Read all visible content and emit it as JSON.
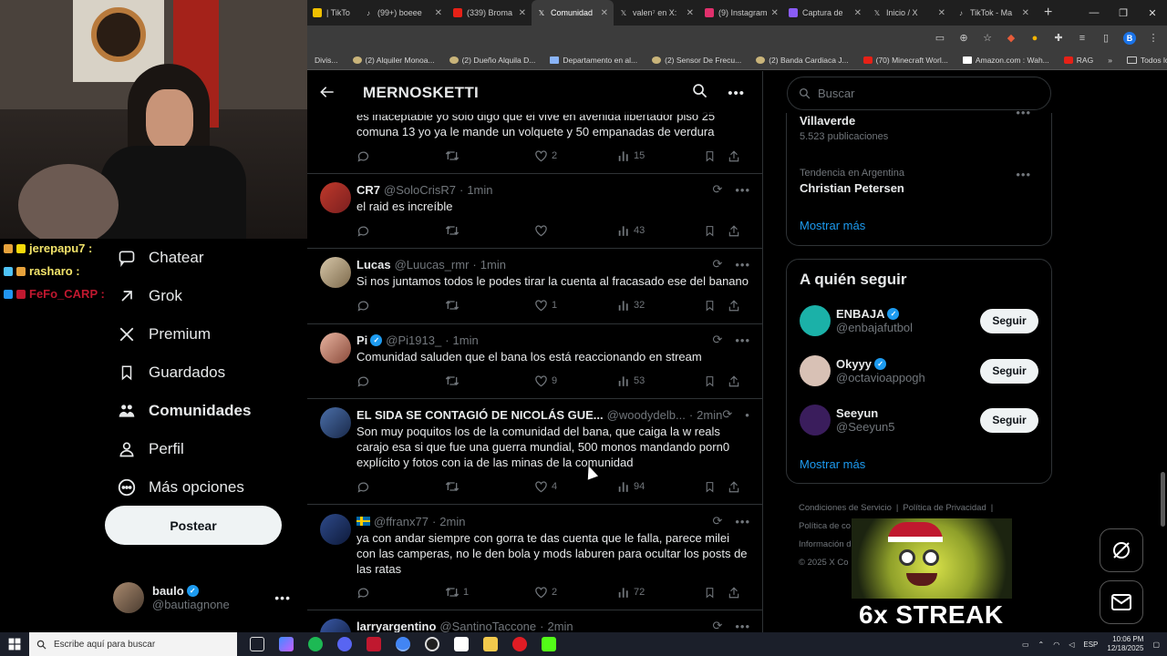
{
  "browser": {
    "tabs": [
      {
        "label": "| TikTo",
        "color": "#f0c000"
      },
      {
        "label": "(99+) boeee",
        "color": "#ffffff"
      },
      {
        "label": "(339) Broma",
        "color": "#e62117"
      },
      {
        "label": "Comunidad",
        "color": "#ffffff",
        "active": true
      },
      {
        "label": "valen⁷ en X:",
        "color": "#ffffff"
      },
      {
        "label": "(9) Instagram",
        "color": "#e1306c"
      },
      {
        "label": "Captura de",
        "color": "#8a5cf6"
      },
      {
        "label": "Inicio / X",
        "color": "#ffffff"
      },
      {
        "label": "TikTok - Ma",
        "color": "#ffffff"
      }
    ],
    "profile_initial": "B",
    "bookmarks": [
      {
        "label": "Divis...",
        "kind": "gen"
      },
      {
        "label": "(2) Alquiler Monoa...",
        "kind": "gen"
      },
      {
        "label": "(2) Dueño Alquila D...",
        "kind": "gen"
      },
      {
        "label": "Departamento en al...",
        "kind": "img"
      },
      {
        "label": "(2) Sensor De Frecu...",
        "kind": "gen"
      },
      {
        "label": "(2) Banda Cardiaca J...",
        "kind": "gen"
      },
      {
        "label": "(70) Minecraft Worl...",
        "kind": "yt"
      },
      {
        "label": "Amazon.com : Wah...",
        "kind": "am"
      },
      {
        "label": "RAG",
        "kind": "yt"
      }
    ],
    "bookmarks_more": "»",
    "all_bookmarks": "Todos los marcadores"
  },
  "stream_chat": [
    {
      "user": "jerepapu7 :",
      "color": "#f2e36a"
    },
    {
      "user": "rasharo :",
      "color": "#f2e36a"
    },
    {
      "user": "FeFo_CARP :",
      "color": "#c0182f"
    }
  ],
  "nav": {
    "items": [
      {
        "label": "Chatear",
        "icon": "chat-icon"
      },
      {
        "label": "Grok",
        "icon": "grok-icon"
      },
      {
        "label": "Premium",
        "icon": "x-logo-icon"
      },
      {
        "label": "Guardados",
        "icon": "bookmark-icon"
      },
      {
        "label": "Comunidades",
        "icon": "communities-icon",
        "active": true
      },
      {
        "label": "Perfil",
        "icon": "profile-icon"
      },
      {
        "label": "Más opciones",
        "icon": "more-options-icon"
      }
    ],
    "post_button": "Postear",
    "account": {
      "name": "baulo",
      "handle": "@bautiagnone"
    }
  },
  "header": {
    "title": "MERNOSKETTI"
  },
  "posts": [
    {
      "text": "es inaceptable yo solo digo que el vive en avenida libertador piso 25 comuna 13 yo ya le mande un volquete y 50 empanadas de verdura",
      "replies": "",
      "reposts": "",
      "likes": "2",
      "views": "15"
    },
    {
      "name": "CR7",
      "handle": "@SoloCrisR7",
      "time": "1min",
      "text": "el raid es increíble",
      "replies": "",
      "reposts": "",
      "likes": "",
      "views": "43"
    },
    {
      "name": "Lucas",
      "handle": "@Luucas_rmr",
      "time": "1min",
      "text": "Si nos juntamos todos le podes tirar la cuenta al fracasado ese del banano",
      "replies": "",
      "reposts": "",
      "likes": "1",
      "views": "32"
    },
    {
      "name": "Pi",
      "handle": "@Pi1913_",
      "time": "1min",
      "text": "Comunidad saluden que el bana los está reaccionando en stream",
      "replies": "",
      "reposts": "",
      "likes": "9",
      "views": "53"
    },
    {
      "name": "EL SIDA SE CONTAGIÓ DE NICOLÁS GUE...",
      "handle": "@woodydelb...",
      "time": "2min",
      "text": "Son muy poquitos los de la comunidad del bana, que caiga la w reals carajo esa si que fue una guerra mundial, 500 monos mandando porn0 explícito y fotos con ia de las minas de la comunidad",
      "replies": "",
      "reposts": "",
      "likes": "4",
      "views": "94"
    },
    {
      "name": "",
      "handle": "@ffranx77",
      "time": "2min",
      "text": "ya con andar siempre con gorra te das cuenta que le falla, parece milei con las camperas, no le den bola y mods laburen para ocultar los posts de las ratas",
      "replies": "",
      "reposts": "1",
      "likes": "2",
      "views": "72"
    },
    {
      "name": "larryargentino",
      "handle": "@SantinoTaccone",
      "time": "2min"
    }
  ],
  "search": {
    "placeholder": "Buscar"
  },
  "trends": [
    {
      "label": "Tendencia en Argentina",
      "name": "Villaverde",
      "count": "5.523 publicaciones"
    },
    {
      "label": "Tendencia en Argentina",
      "name": "Christian Petersen",
      "count": ""
    }
  ],
  "trends_more": "Mostrar más",
  "who_to_follow": {
    "title": "A quién seguir",
    "accounts": [
      {
        "name": "ENBAJA",
        "handle": "@enbajafutbol",
        "button": "Seguir",
        "color": "#1bb1a8"
      },
      {
        "name": "Okyyy",
        "handle": "@octavioappogh",
        "button": "Seguir",
        "color": "#d8c1b5"
      },
      {
        "name": "Seeyun",
        "handle": "@Seeyun5",
        "button": "Seguir",
        "color": "#3a1d5c"
      }
    ],
    "more": "Mostrar más"
  },
  "footer": {
    "links": [
      "Condiciones de Servicio",
      "Política de Privacidad",
      "Política de co",
      "Información d",
      "© 2025 X Co"
    ]
  },
  "overlay": {
    "streak_text": "6x STREAK"
  },
  "taskbar": {
    "search_placeholder": "Escribe aquí para buscar",
    "lang": "ESP",
    "time": "10:06 PM",
    "date": "12/18/2025"
  }
}
